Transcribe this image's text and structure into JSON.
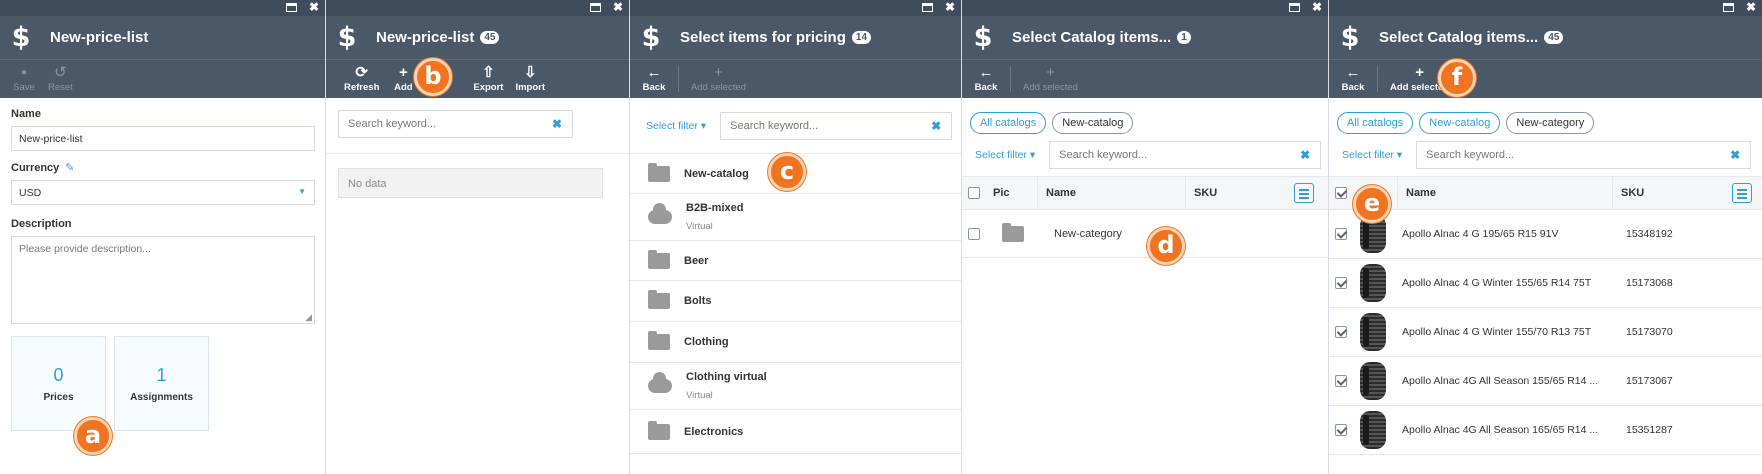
{
  "blade1": {
    "title": "New-price-list",
    "toolbar": {
      "save": "Save",
      "reset": "Reset"
    },
    "name_label": "Name",
    "name_value": "New-price-list",
    "currency_label": "Currency",
    "currency_value": "USD",
    "description_label": "Description",
    "description_placeholder": "Please provide description...",
    "widgets": [
      {
        "value": "0",
        "label": "Prices"
      },
      {
        "value": "1",
        "label": "Assignments"
      }
    ],
    "badge": "a"
  },
  "blade2": {
    "title": "New-price-list",
    "count": "45",
    "toolbar": {
      "refresh": "Refresh",
      "add": "Add",
      "export": "Export",
      "import": "Import"
    },
    "search_placeholder": "Search keyword...",
    "no_data": "No data",
    "badge": "b"
  },
  "blade3": {
    "title": "Select items for pricing",
    "count": "14",
    "toolbar": {
      "back": "Back",
      "add_selected": "Add selected"
    },
    "filter": "Select filter",
    "search_placeholder": "Search keyword...",
    "items": [
      {
        "name": "New-catalog",
        "sub": "",
        "icon": "folder-icon"
      },
      {
        "name": "B2B-mixed",
        "sub": "Virtual",
        "icon": "cloud-icon"
      },
      {
        "name": "Beer",
        "sub": "",
        "icon": "folder-icon"
      },
      {
        "name": "Bolts",
        "sub": "",
        "icon": "folder-icon"
      },
      {
        "name": "Clothing",
        "sub": "",
        "icon": "folder-icon"
      },
      {
        "name": "Clothing virtual",
        "sub": "Virtual",
        "icon": "cloud-icon"
      },
      {
        "name": "Electronics",
        "sub": "",
        "icon": "folder-icon"
      }
    ],
    "badge": "c"
  },
  "blade4": {
    "title": "Select Catalog items...",
    "count": "1",
    "toolbar": {
      "back": "Back",
      "add_selected": "Add selected"
    },
    "breadcrumbs": [
      "All catalogs",
      "New-catalog"
    ],
    "filter": "Select filter",
    "search_placeholder": "Search keyword...",
    "columns": {
      "pic": "Pic",
      "name": "Name",
      "sku": "SKU"
    },
    "rows": [
      {
        "name": "New-category",
        "sku": ""
      }
    ],
    "badge": "d"
  },
  "blade5": {
    "title": "Select Catalog items...",
    "count": "45",
    "toolbar": {
      "back": "Back",
      "add_selected": "Add selected"
    },
    "breadcrumbs": [
      "All catalogs",
      "New-catalog",
      "New-category"
    ],
    "filter": "Select filter",
    "search_placeholder": "Search keyword...",
    "columns": {
      "name": "Name",
      "sku": "SKU"
    },
    "rows": [
      {
        "name": "Apollo Alnac 4 G 195/65 R15 91V",
        "sku": "15348192"
      },
      {
        "name": "Apollo Alnac 4 G Winter 155/65 R14 75T",
        "sku": "15173068"
      },
      {
        "name": "Apollo Alnac 4 G Winter 155/70 R13 75T",
        "sku": "15173070"
      },
      {
        "name": "Apollo Alnac 4G All Season 155/65 R14 ...",
        "sku": "15173067"
      },
      {
        "name": "Apollo Alnac 4G All Season 165/65 R14 ...",
        "sku": "15351287"
      }
    ],
    "badge_e": "e",
    "badge_f": "f"
  },
  "colors": {
    "header": "#4a5868",
    "topbar": "#3f4c5c",
    "accent": "#2f9fd8",
    "badge": "#f0741f"
  }
}
